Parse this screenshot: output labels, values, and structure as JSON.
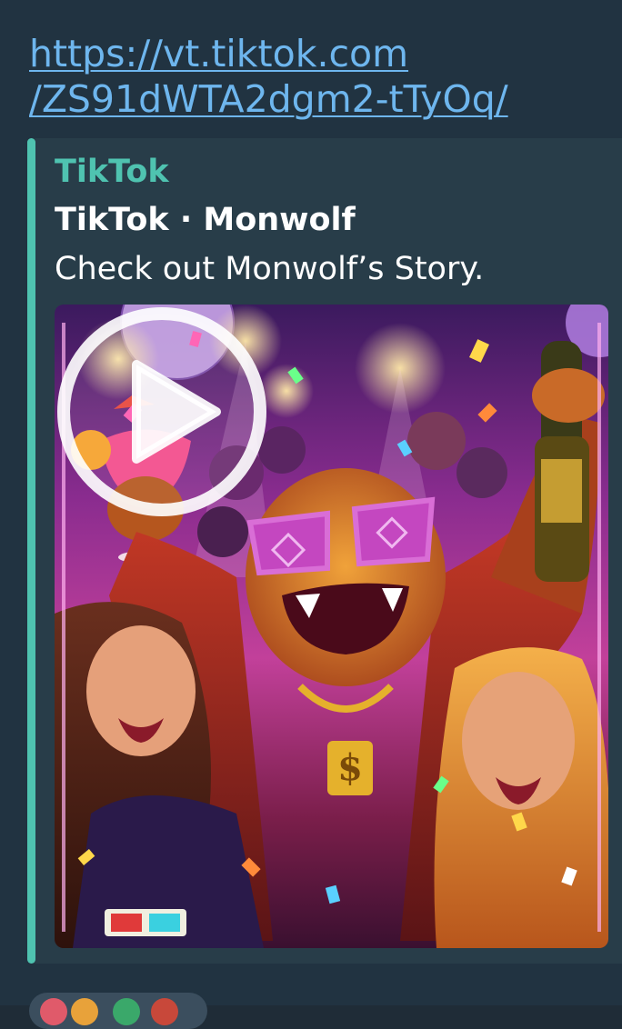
{
  "message": {
    "link_line1": "https://vt.tiktok.com",
    "link_line2": "/ZS91dWTA2dgm2-tTyOq/"
  },
  "preview": {
    "site_name": "TikTok",
    "title": "TikTok · Monwolf",
    "description": "Check out Monwolf’s Story."
  },
  "colors": {
    "accent": "#4fc3b0",
    "link": "#6eb6ee",
    "bubble_bg": "#213341",
    "preview_bg": "#283d49"
  },
  "icons": {
    "play": "play-circle-icon"
  }
}
